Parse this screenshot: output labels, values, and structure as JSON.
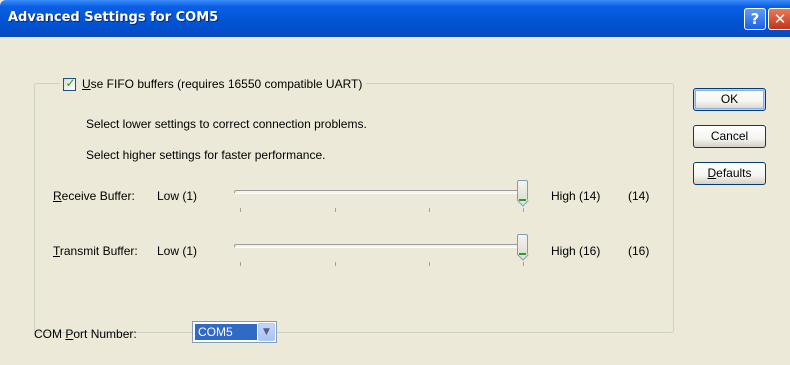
{
  "window": {
    "title": "Advanced Settings for COM5",
    "help_glyph": "?",
    "close_glyph": "✕"
  },
  "fifo": {
    "checked": true,
    "label_accel": "U",
    "label_rest": "se FIFO buffers (requires 16550 compatible UART)"
  },
  "info": {
    "line1": "Select lower settings to correct connection problems.",
    "line2": "Select higher settings for faster performance."
  },
  "receive": {
    "label_accel": "R",
    "label_rest": "eceive Buffer:",
    "low": "Low (1)",
    "high": "High (14)",
    "value": "(14)",
    "level": 1.0
  },
  "transmit": {
    "label_accel": "T",
    "label_rest": "ransmit Buffer:",
    "low": "Low (1)",
    "high": "High (16)",
    "value": "(16)",
    "level": 1.0
  },
  "buttons": {
    "ok": "OK",
    "cancel": "Cancel",
    "defaults_accel": "D",
    "defaults_rest": "efaults"
  },
  "port": {
    "label_pre": "COM ",
    "label_accel": "P",
    "label_rest": "ort Number:",
    "selected": "COM5"
  },
  "icons": {
    "check": "check-icon",
    "dropdown": "chevron-down-icon"
  },
  "colors": {
    "titlebar": "#0356D6",
    "dialog_bg": "#ECE9D8",
    "selection": "#316AC5",
    "accent_green": "#21A121"
  }
}
